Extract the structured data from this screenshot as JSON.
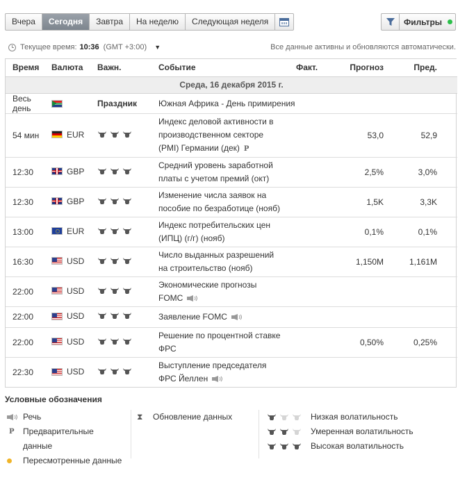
{
  "toolbar": {
    "tabs": [
      "Вчера",
      "Сегодня",
      "Завтра",
      "На неделю",
      "Следующая неделя"
    ],
    "active_tab": "Сегодня",
    "calendar_icon": "calendar-icon",
    "filters_label": "Фильтры",
    "filters_dot_color": "#2bbf4a"
  },
  "timebar": {
    "label": "Текущее время:",
    "time": "10:36",
    "tz": "(GMT +3:00)",
    "status": "Все данные активны и обновляются автоматически."
  },
  "table": {
    "headers": {
      "time": "Время",
      "currency": "Валюта",
      "importance": "Важн.",
      "event": "Событие",
      "actual": "Факт.",
      "forecast": "Прогноз",
      "previous": "Пред."
    },
    "date": "Среда, 16 декабря 2015 г.",
    "holiday": {
      "time": "Весь день",
      "flag": "za",
      "label": "Праздник",
      "event": "Южная Африка - День примирения"
    },
    "rows": [
      {
        "time": "54 мин",
        "flag": "de",
        "currency": "EUR",
        "bulls": 3,
        "event_l1": "Индекс деловой активности в",
        "event_l2": "производственном секторе",
        "event_l3": "(PMI) Германии (дек)",
        "prelim": "P",
        "actual": "",
        "forecast": "53,0",
        "previous": "52,9"
      },
      {
        "time": "12:30",
        "flag": "gb",
        "currency": "GBP",
        "bulls": 3,
        "event_l1": "Средний уровень заработной",
        "event_l2": "платы с учетом премий (окт)",
        "actual": "",
        "forecast": "2,5%",
        "previous": "3,0%"
      },
      {
        "time": "12:30",
        "flag": "gb",
        "currency": "GBP",
        "bulls": 3,
        "event_l1": "Изменение числа заявок на",
        "event_l2": "пособие по безработице (нояб)",
        "actual": "",
        "forecast": "1,5K",
        "previous": "3,3K"
      },
      {
        "time": "13:00",
        "flag": "eu",
        "currency": "EUR",
        "bulls": 3,
        "event_l1": "Индекс потребительских цен",
        "event_l2": "(ИПЦ) (г/г) (нояб)",
        "actual": "",
        "forecast": "0,1%",
        "previous": "0,1%"
      },
      {
        "time": "16:30",
        "flag": "us",
        "currency": "USD",
        "bulls": 3,
        "event_l1": "Число выданных разрешений",
        "event_l2": "на строительство (нояб)",
        "actual": "",
        "forecast": "1,150M",
        "previous": "1,161M"
      },
      {
        "time": "22:00",
        "flag": "us",
        "currency": "USD",
        "bulls": 3,
        "event_l1": "Экономические прогнозы",
        "event_l2": "FOMC",
        "speech": true,
        "actual": "",
        "forecast": "",
        "previous": ""
      },
      {
        "time": "22:00",
        "flag": "us",
        "currency": "USD",
        "bulls": 3,
        "event_l1": "Заявление FOMC",
        "speech": true,
        "actual": "",
        "forecast": "",
        "previous": ""
      },
      {
        "time": "22:00",
        "flag": "us",
        "currency": "USD",
        "bulls": 3,
        "event_l1": "Решение по процентной ставке",
        "event_l2": "ФРС",
        "actual": "",
        "forecast": "0,50%",
        "previous": "0,25%"
      },
      {
        "time": "22:30",
        "flag": "us",
        "currency": "USD",
        "bulls": 3,
        "event_l1": "Выступление председателя",
        "event_l2": "ФРС Йеллен",
        "speech": true,
        "actual": "",
        "forecast": "",
        "previous": ""
      }
    ]
  },
  "legend": {
    "title": "Условные обозначения",
    "speech": "Речь",
    "prelim_symbol": "P",
    "prelim_l1": "Предварительные",
    "prelim_l2": "данные",
    "revised": "Пересмотренные данные",
    "revised_color": "#f0b428",
    "update": "Обновление данных",
    "low": "Низкая волатильность",
    "medium": "Умеренная волатильность",
    "high": "Высокая волатильность"
  }
}
